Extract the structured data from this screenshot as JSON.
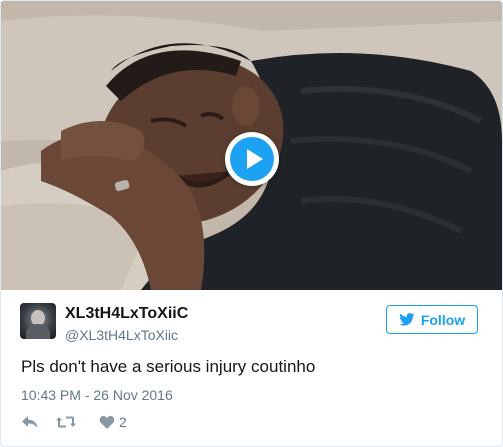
{
  "media": {
    "type": "video",
    "icon": "play-icon",
    "accent": "#1da1f2"
  },
  "author": {
    "display_name": "XL3tH4LxToXiiC",
    "handle": "@XL3tH4LxToXiic",
    "avatar_icon": "avatar"
  },
  "follow_button": {
    "label": "Follow",
    "icon": "twitter-bird-icon"
  },
  "tweet": {
    "text": "Pls don't have a serious injury coutinho",
    "timestamp": "10:43 PM - 26 Nov 2016"
  },
  "actions": {
    "reply_icon": "reply-icon",
    "retweet_icon": "retweet-icon",
    "like_icon": "heart-icon",
    "like_count": "2"
  },
  "colors": {
    "text_primary": "#14171a",
    "text_secondary": "#657786",
    "border": "#e1e8ed",
    "brand": "#1da1f2"
  }
}
